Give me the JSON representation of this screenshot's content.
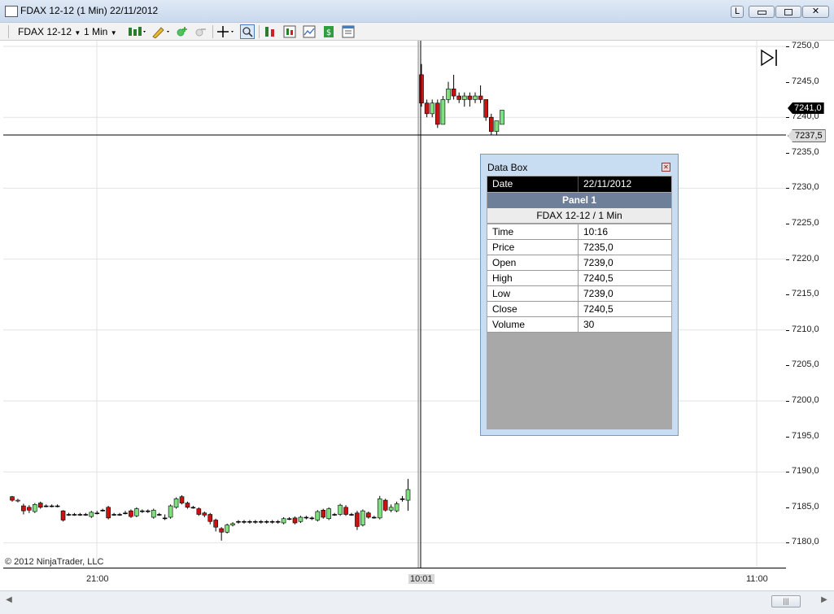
{
  "window": {
    "title": "FDAX 12-12 (1 Min)  22/11/2012",
    "btn_l": "L"
  },
  "toolbar": {
    "instrument": "FDAX 12-12",
    "interval": "1 Min"
  },
  "price_axis": {
    "ticks": [
      "7250,0",
      "7245,0",
      "7240,0",
      "7235,0",
      "7230,0",
      "7225,0",
      "7220,0",
      "7215,0",
      "7210,0",
      "7205,0",
      "7200,0",
      "7195,0",
      "7190,0",
      "7185,0",
      "7180,0"
    ],
    "last_price": "7241,0",
    "crosshair_price": "7237,5"
  },
  "time_axis": {
    "ticks": [
      "21:00",
      "10:01",
      "11:00"
    ]
  },
  "copyright": "© 2012 NinjaTrader, LLC",
  "data_box": {
    "title": "Data Box",
    "date_label": "Date",
    "date_value": "22/11/2012",
    "panel": "Panel 1",
    "series": "FDAX 12-12 / 1 Min",
    "rows": [
      {
        "label": "Time",
        "value": "10:16"
      },
      {
        "label": "Price",
        "value": "7235,0"
      },
      {
        "label": "Open",
        "value": "7239,0"
      },
      {
        "label": "High",
        "value": "7240,5"
      },
      {
        "label": "Low",
        "value": "7239,0"
      },
      {
        "label": "Close",
        "value": "7240,5"
      },
      {
        "label": "Volume",
        "value": "30"
      }
    ]
  },
  "colors": {
    "up": "#7fe07f",
    "down": "#cc1111",
    "grid": "#e2e2e2"
  }
}
